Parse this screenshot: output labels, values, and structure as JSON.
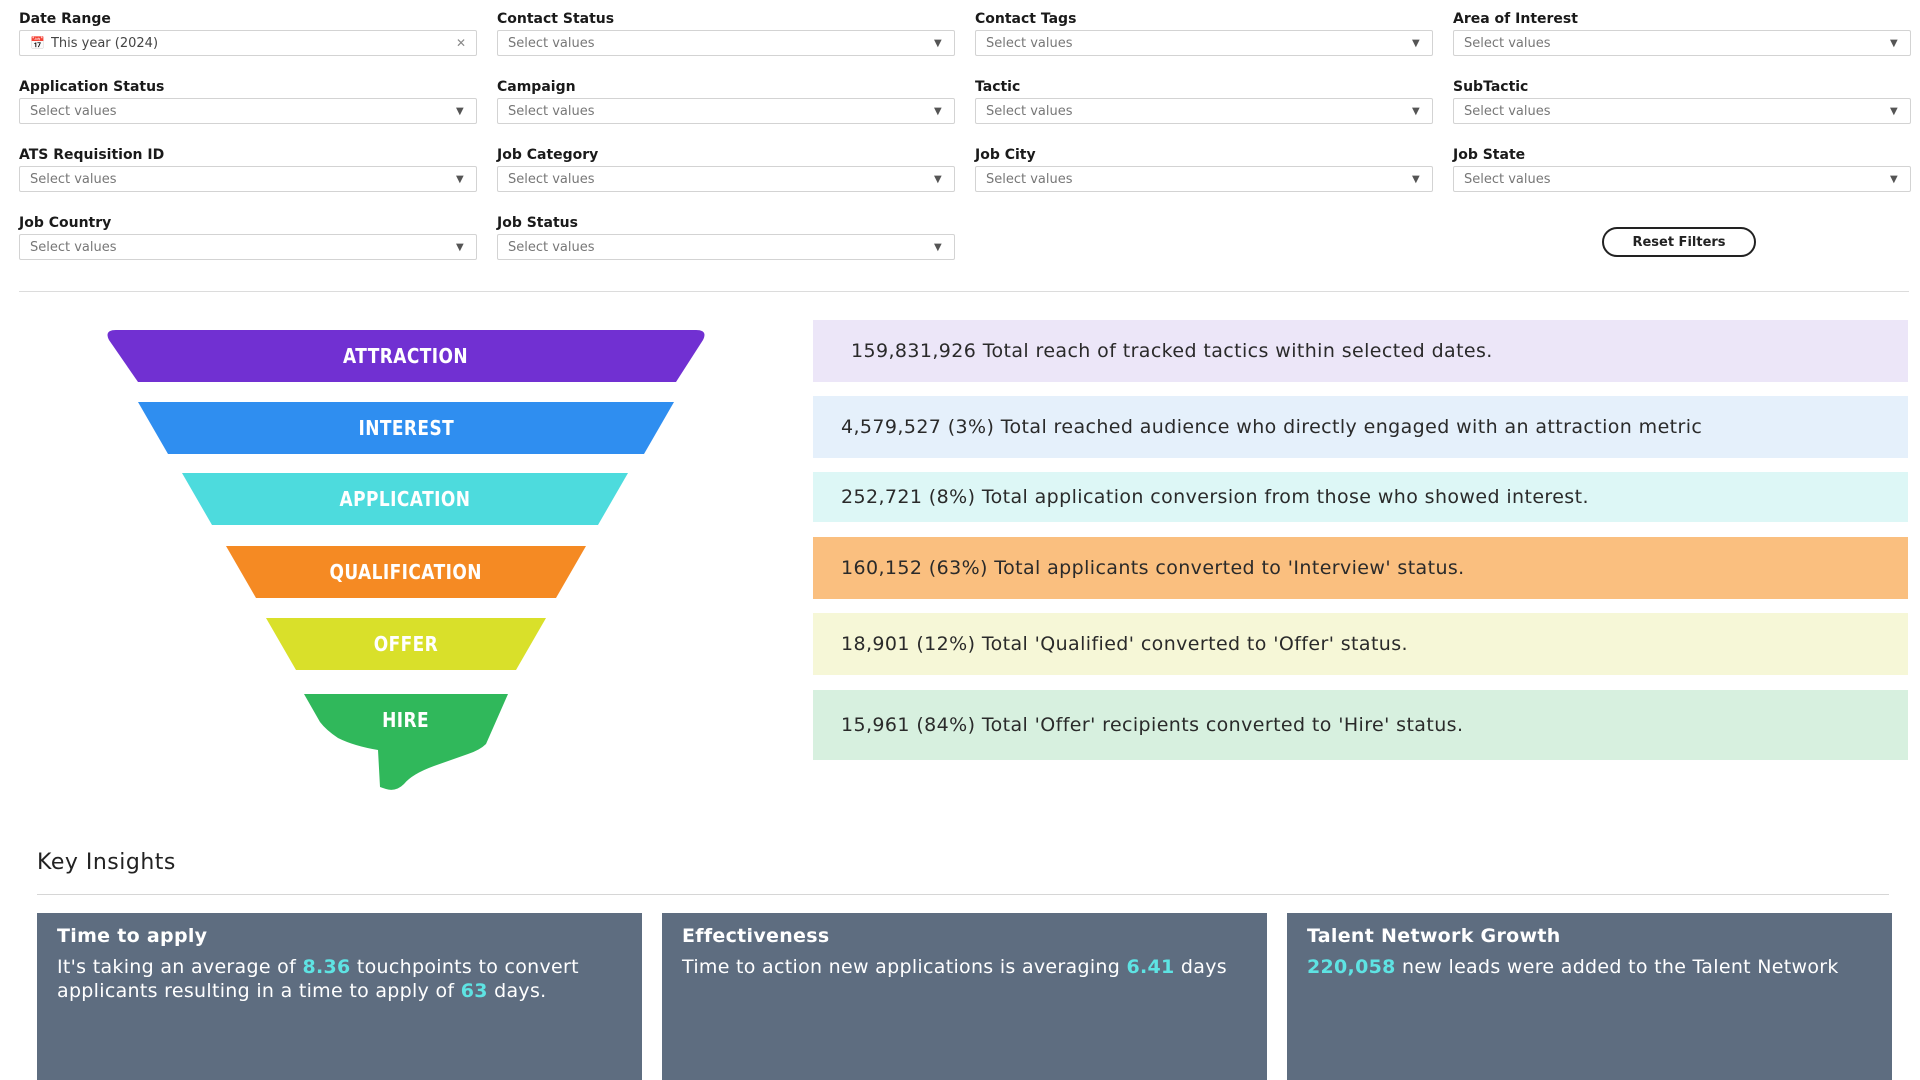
{
  "filters": [
    {
      "label": "Date Range",
      "value": "This year (2024)",
      "type": "date"
    },
    {
      "label": "Contact Status",
      "value": "Select values"
    },
    {
      "label": "Contact Tags",
      "value": "Select values"
    },
    {
      "label": "Area of Interest",
      "value": "Select values"
    },
    {
      "label": "Application Status",
      "value": "Select values"
    },
    {
      "label": "Campaign",
      "value": "Select values"
    },
    {
      "label": "Tactic",
      "value": "Select values"
    },
    {
      "label": "SubTactic",
      "value": "Select values"
    },
    {
      "label": "ATS Requisition ID",
      "value": "Select values"
    },
    {
      "label": "Job Category",
      "value": "Select values"
    },
    {
      "label": "Job City",
      "value": "Select values"
    },
    {
      "label": "Job State",
      "value": "Select values"
    },
    {
      "label": "Job Country",
      "value": "Select values"
    },
    {
      "label": "Job Status",
      "value": "Select values"
    }
  ],
  "reset_label": "Reset Filters",
  "funnel": [
    {
      "label": "ATTRACTION",
      "color": "#7130d2"
    },
    {
      "label": "INTEREST",
      "color": "#2f8ef0"
    },
    {
      "label": "APPLICATION",
      "color": "#4ddbdd"
    },
    {
      "label": "QUALIFICATION",
      "color": "#f58a23"
    },
    {
      "label": "OFFER",
      "color": "#d9e02a"
    },
    {
      "label": "HIRE",
      "color": "#30b85b"
    }
  ],
  "metrics": [
    {
      "text": "159,831,926 Total reach of tracked tactics within selected dates.",
      "bg": "#ece6f8"
    },
    {
      "text": "4,579,527 (3%) Total reached audience who directly engaged with an attraction metric",
      "bg": "#e5f0fb"
    },
    {
      "text": "252,721 (8%) Total application conversion from those who showed interest.",
      "bg": "#ddf7f6"
    },
    {
      "text": "160,152 (63%) Total applicants converted to 'Interview' status.",
      "bg": "#fabf7f"
    },
    {
      "text": "18,901 (12%)  Total 'Qualified' converted to 'Offer' status.",
      "bg": "#f6f7d7"
    },
    {
      "text": "15,961 (84%) Total 'Offer' recipients converted to 'Hire' status.",
      "bg": "#d7f0df"
    }
  ],
  "insights": {
    "title": "Key Insights",
    "cards": [
      {
        "title": "Time to apply",
        "t1": "It's taking an average of ",
        "v1": "8.36",
        "t2": " touchpoints to convert applicants resulting in a time to apply of ",
        "v2": "63",
        "t3": " days."
      },
      {
        "title": "Effectiveness",
        "t1": "Time to action new applications is averaging ",
        "v1": "6.41",
        "t2": " days",
        "v2": "",
        "t3": ""
      },
      {
        "title": "Talent Network Growth",
        "t1": "",
        "v1": "220,058",
        "t2": " new leads were added to the Talent Network",
        "v2": "",
        "t3": ""
      }
    ]
  }
}
